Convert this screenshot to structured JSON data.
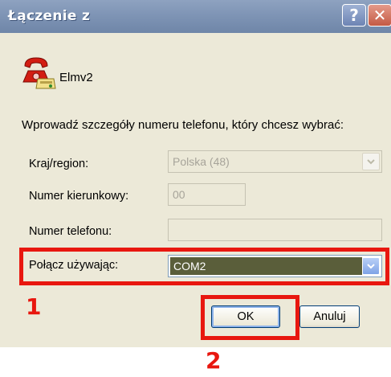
{
  "window": {
    "title": "Łączenie z",
    "help_glyph": "?",
    "close_glyph": "✕"
  },
  "connection": {
    "name": "Elmv2",
    "icon": "phone-icon"
  },
  "instruction": "Wprowadź szczegóły numeru telefonu, który chcesz wybrać:",
  "fields": {
    "country": {
      "label": "Kraj/region:",
      "value": "Polska (48)",
      "enabled": false
    },
    "area_code": {
      "label": "Numer kierunkowy:",
      "value": "00",
      "enabled": false
    },
    "phone": {
      "label": "Numer telefonu:",
      "value": "",
      "enabled": false
    },
    "connect_using": {
      "label": "Połącz używając:",
      "value": "COM2",
      "enabled": true
    }
  },
  "buttons": {
    "ok": "OK",
    "cancel": "Anuluj"
  },
  "annotations": {
    "marker_1": "1",
    "marker_2": "2",
    "color": "#e8170f"
  },
  "colors": {
    "titlebar": "#7d93b4",
    "dialog_bg": "#ece9d8",
    "selection": "#5a5e3a"
  }
}
